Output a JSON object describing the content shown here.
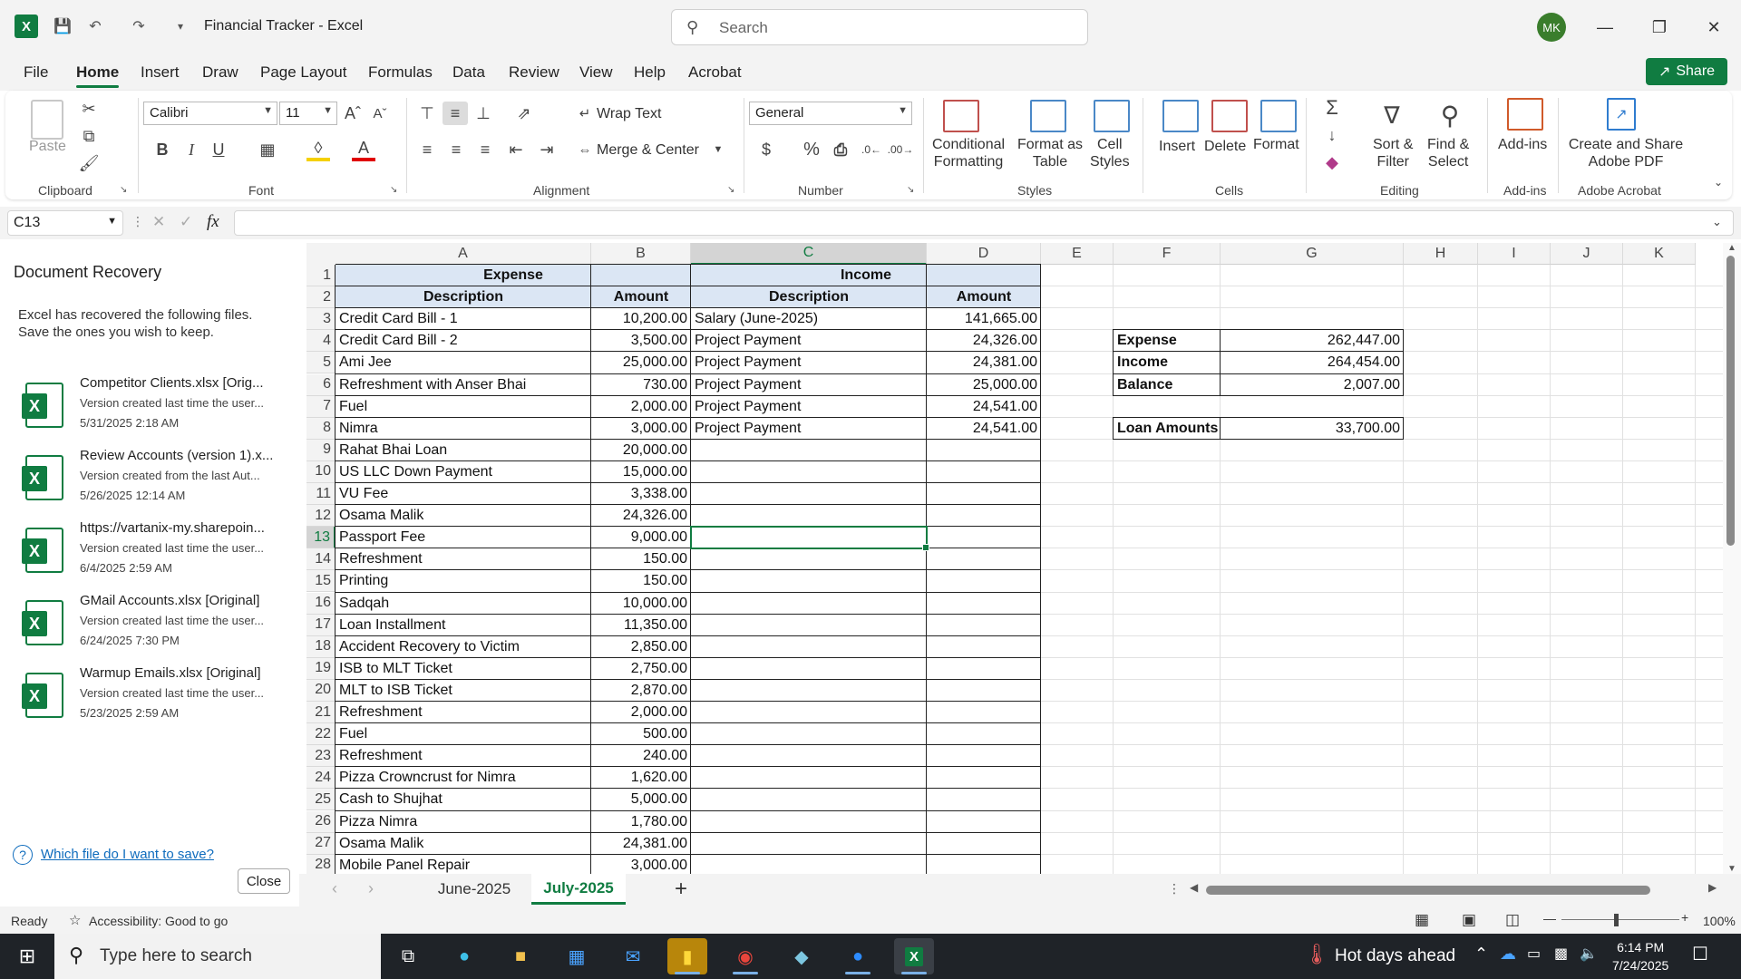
{
  "titlebar": {
    "doc_title": "Financial Tracker  -  Excel",
    "search_placeholder": "Search",
    "avatar_initials": "MK"
  },
  "menu": {
    "tabs": [
      "File",
      "Home",
      "Insert",
      "Draw",
      "Page Layout",
      "Formulas",
      "Data",
      "Review",
      "View",
      "Help",
      "Acrobat"
    ],
    "active": "Home",
    "share_label": "Share"
  },
  "ribbon": {
    "paste": "Paste",
    "clipboard": "Clipboard",
    "font_name": "Calibri",
    "font_size": "11",
    "font_group": "Font",
    "wrap_text": "Wrap Text",
    "merge_center": "Merge & Center",
    "alignment_group": "Alignment",
    "number_format": "General",
    "number_group": "Number",
    "conditional_formatting": [
      "Conditional",
      "Formatting"
    ],
    "format_as_table": [
      "Format as",
      "Table"
    ],
    "cell_styles": [
      "Cell",
      "Styles"
    ],
    "styles_group": "Styles",
    "insert": "Insert",
    "delete": "Delete",
    "format": "Format",
    "cells_group": "Cells",
    "sort_filter": [
      "Sort &",
      "Filter"
    ],
    "find_select": [
      "Find &",
      "Select"
    ],
    "editing_group": "Editing",
    "add_ins": "Add-ins",
    "add_ins_group": "Add-ins",
    "create_share": [
      "Create and Share",
      "Adobe PDF"
    ],
    "acrobat_group": "Adobe Acrobat"
  },
  "formula_bar": {
    "name_box": "C13",
    "fx": "fx",
    "formula": ""
  },
  "recovery": {
    "title": "Document Recovery",
    "description": "Excel has recovered the following files. Save the ones you wish to keep.",
    "files": [
      {
        "name": "Competitor Clients.xlsx  [Orig...",
        "note": "Version created last time the user...",
        "date": "5/31/2025 2:18 AM"
      },
      {
        "name": "Review Accounts (version 1).x...",
        "note": "Version created from the last Aut...",
        "date": "5/26/2025 12:14 AM"
      },
      {
        "name": "https://vartanix-my.sharepoin...",
        "note": "Version created last time the user...",
        "date": "6/4/2025 2:59 AM"
      },
      {
        "name": "GMail Accounts.xlsx  [Original]",
        "note": "Version created last time the user...",
        "date": "6/24/2025 7:30 PM"
      },
      {
        "name": "Warmup Emails.xlsx  [Original]",
        "note": "Version created last time the user...",
        "date": "5/23/2025 2:59 AM"
      }
    ],
    "help_link": "Which file do I want to save?",
    "close_label": "Close"
  },
  "sheet": {
    "columns": [
      "A",
      "B",
      "C",
      "D",
      "E",
      "F",
      "G",
      "H",
      "I",
      "J",
      "K"
    ],
    "selected_column": "C",
    "selected_row": 13,
    "row_numbers": [
      1,
      2,
      3,
      4,
      5,
      6,
      7,
      8,
      9,
      10,
      11,
      12,
      13,
      14,
      15,
      16,
      17,
      18,
      19,
      20,
      21,
      22,
      23,
      24,
      25,
      26,
      27,
      28
    ],
    "expense_header": "Expense",
    "income_header": "Income",
    "desc_header": "Description",
    "amount_header": "Amount",
    "expenses": [
      {
        "desc": "Credit Card Bill - 1",
        "amount": "10,200.00"
      },
      {
        "desc": "Credit Card Bill - 2",
        "amount": "3,500.00"
      },
      {
        "desc": "Ami Jee",
        "amount": "25,000.00"
      },
      {
        "desc": "Refreshment with Anser Bhai",
        "amount": "730.00"
      },
      {
        "desc": "Fuel",
        "amount": "2,000.00"
      },
      {
        "desc": "Nimra",
        "amount": "3,000.00"
      },
      {
        "desc": "Rahat Bhai Loan",
        "amount": "20,000.00"
      },
      {
        "desc": "US LLC Down Payment",
        "amount": "15,000.00"
      },
      {
        "desc": "VU Fee",
        "amount": "3,338.00"
      },
      {
        "desc": "Osama Malik",
        "amount": "24,326.00"
      },
      {
        "desc": "Passport Fee",
        "amount": "9,000.00"
      },
      {
        "desc": "Refreshment",
        "amount": "150.00"
      },
      {
        "desc": "Printing",
        "amount": "150.00"
      },
      {
        "desc": "Sadqah",
        "amount": "10,000.00"
      },
      {
        "desc": "Loan Installment",
        "amount": "11,350.00"
      },
      {
        "desc": "Accident Recovery to Victim",
        "amount": "2,850.00"
      },
      {
        "desc": "ISB to MLT Ticket",
        "amount": "2,750.00"
      },
      {
        "desc": "MLT to ISB Ticket",
        "amount": "2,870.00"
      },
      {
        "desc": "Refreshment",
        "amount": "2,000.00"
      },
      {
        "desc": "Fuel",
        "amount": "500.00"
      },
      {
        "desc": "Refreshment",
        "amount": "240.00"
      },
      {
        "desc": "Pizza Crowncrust for Nimra",
        "amount": "1,620.00"
      },
      {
        "desc": "Cash to Shujhat",
        "amount": "5,000.00"
      },
      {
        "desc": "Pizza Nimra",
        "amount": "1,780.00"
      },
      {
        "desc": "Osama Malik",
        "amount": "24,381.00"
      },
      {
        "desc": "Mobile Panel Repair",
        "amount": "3,000.00"
      }
    ],
    "incomes": [
      {
        "desc": "Salary (June-2025)",
        "amount": "141,665.00"
      },
      {
        "desc": "Project Payment",
        "amount": "24,326.00"
      },
      {
        "desc": "Project Payment",
        "amount": "24,381.00"
      },
      {
        "desc": "Project Payment",
        "amount": "25,000.00"
      },
      {
        "desc": "Project Payment",
        "amount": "24,541.00"
      },
      {
        "desc": "Project Payment",
        "amount": "24,541.00"
      }
    ],
    "summary": [
      {
        "label": "Expense",
        "value": "262,447.00"
      },
      {
        "label": "Income",
        "value": "264,454.00"
      },
      {
        "label": "Balance",
        "value": "2,007.00"
      }
    ],
    "loan": {
      "label": "Loan Amounts",
      "value": "33,700.00"
    }
  },
  "sheet_tabs": {
    "tabs": [
      "June-2025",
      "July-2025"
    ],
    "active": "July-2025"
  },
  "status": {
    "ready": "Ready",
    "accessibility": "Accessibility: Good to go",
    "zoom": "100%"
  },
  "taskbar": {
    "search_placeholder": "Type here to search",
    "weather": "Hot days ahead",
    "time": "6:14 PM",
    "date": "7/24/2025"
  },
  "colors": {
    "excel_green": "#107c41",
    "header_fill": "#dbe6f4",
    "taskbar": "#1f2328"
  }
}
